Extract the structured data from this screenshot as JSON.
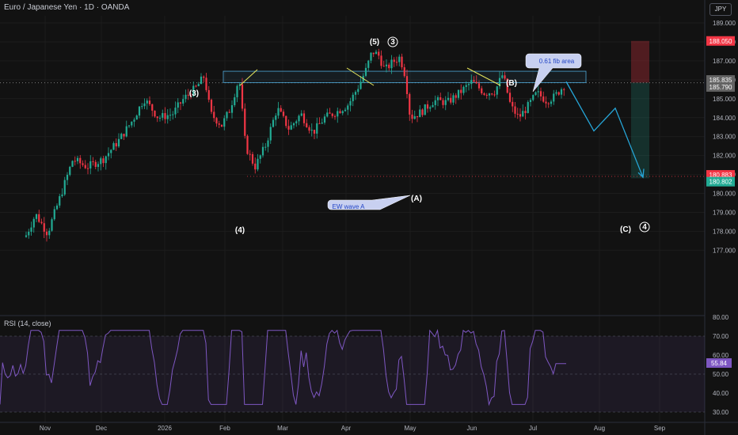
{
  "header": {
    "title": "Euro / Japanese Yen · 1D · OANDA",
    "currency": "JPY",
    "rsi_title": "RSI (14, close)"
  },
  "colors": {
    "up": "#22ab94",
    "down": "#f23645",
    "rsi": "#7e57c2",
    "fib_box": "#4fa8d8",
    "projection": "#26a6d8",
    "arrow": "#e6e65c"
  },
  "chart_data": [
    {
      "type": "candlestick",
      "title": "Euro / Japanese Yen · 1D · OANDA",
      "ylim": [
        177.0,
        189.0
      ],
      "yticks": [
        "189.000",
        "188.000",
        "187.000",
        "186.000",
        "185.000",
        "184.000",
        "183.000",
        "182.000",
        "181.000",
        "180.000",
        "179.000",
        "178.000",
        "177.000"
      ],
      "xticks": [
        "Nov",
        "Dec",
        "2026",
        "Feb",
        "Mar",
        "Apr",
        "May",
        "Jun",
        "Jul",
        "Aug",
        "Sep"
      ],
      "price_tags": [
        {
          "label": "188.050",
          "color": "#f23645"
        },
        {
          "label": "185.835",
          "color": "#636363"
        },
        {
          "label": "185.790",
          "color": "#636363"
        },
        {
          "label": "180.883",
          "color": "#f23645"
        },
        {
          "label": "180.802",
          "color": "#22ab94"
        }
      ],
      "wave_labels": [
        "(3)",
        "(5)",
        "3",
        "(4)",
        "(A)",
        "(B)",
        "(C)",
        "4"
      ],
      "annotations": [
        "0.61 fib area",
        "EW wave A"
      ],
      "fib_zone": [
        185.85,
        186.45
      ],
      "support_line": 180.9,
      "projection": [
        185.9,
        183.3,
        184.5,
        180.85
      ],
      "position": {
        "entry": 185.85,
        "stop": 188.05,
        "target": 180.8
      }
    },
    {
      "type": "line",
      "title": "RSI (14, close)",
      "ylim": [
        30,
        80
      ],
      "yticks": [
        "80.00",
        "70.00",
        "60.00",
        "50.00",
        "40.00",
        "30.00"
      ],
      "last_value": "55.84",
      "bands": [
        70,
        30
      ]
    }
  ]
}
